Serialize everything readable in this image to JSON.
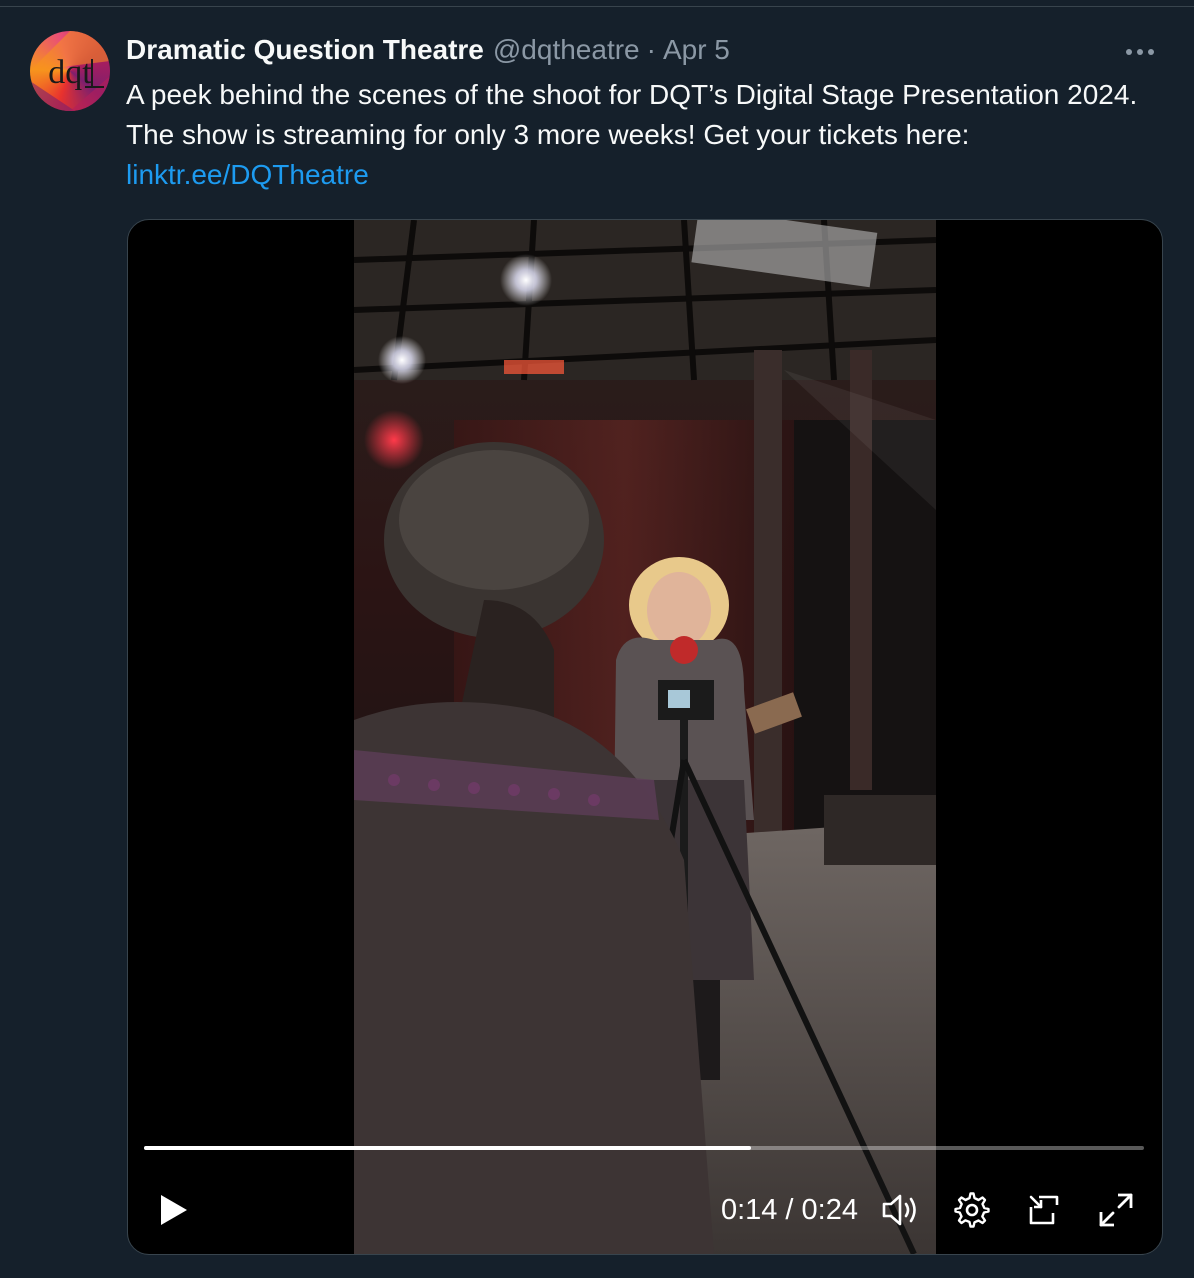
{
  "tweet": {
    "display_name": "Dramatic Question Theatre",
    "handle": "@dqtheatre",
    "separator": "·",
    "date": "Apr 5",
    "more_icon": "more-horizontal-icon",
    "avatar_text": "dqt",
    "text": "A peek behind the scenes of the shoot for DQT’s Digital Stage Presentation 2024. The show is streaming for only 3 more weeks! Get your tickets here:",
    "link": "linktr.ee/DQTheatre"
  },
  "video": {
    "current_time": "0:14",
    "duration": "0:24",
    "time_display": "0:14 / 0:24",
    "progress_fraction": 0.6068,
    "controls": {
      "play": "play-icon",
      "volume": "volume-icon",
      "settings": "gear-icon",
      "picture_in_picture": "pip-icon",
      "fullscreen": "fullscreen-icon"
    }
  },
  "colors": {
    "background": "#15202b",
    "link": "#1d9bf0",
    "muted_text": "#8b98a5",
    "border": "#38444d"
  }
}
